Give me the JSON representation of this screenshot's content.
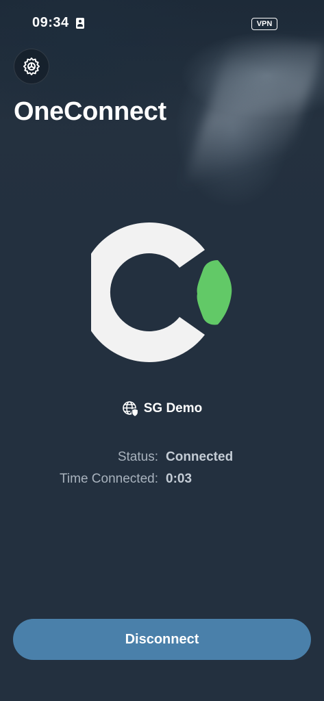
{
  "status_bar": {
    "time": "09:34",
    "vpn_badge": "VPN",
    "icons": [
      "id-card-icon"
    ]
  },
  "header": {
    "settings_icon": "gear-icon",
    "title": "OneConnect"
  },
  "logo": {
    "icon": "oneconnect-logo-icon",
    "colors": {
      "ring": "#f2f2f2",
      "accent": "#62c967"
    }
  },
  "server": {
    "icon": "globe-shield-icon",
    "name": "SG Demo"
  },
  "connection_info": [
    {
      "label": "Status:",
      "value": "Connected"
    },
    {
      "label": "Time Connected:",
      "value": "0:03"
    }
  ],
  "actions": {
    "disconnect_label": "Disconnect"
  },
  "colors": {
    "background": "#23303f",
    "button": "#4a80aa",
    "label_text": "#a9b3be",
    "value_text": "#c4ccd5"
  }
}
